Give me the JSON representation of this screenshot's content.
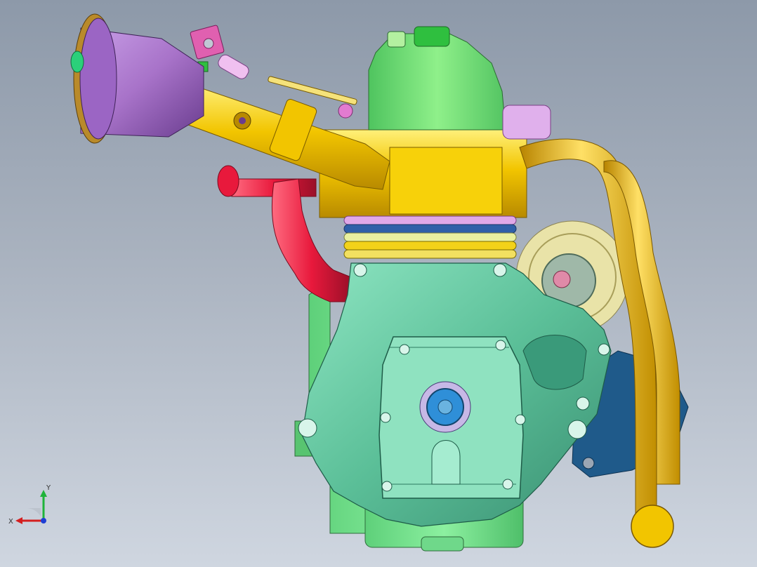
{
  "viewport": {
    "background_top": "#8d99a9",
    "background_bottom": "#cfd6e0"
  },
  "model": {
    "parts": [
      {
        "name": "air-filter",
        "color": "#a873c9"
      },
      {
        "name": "intake-pipe",
        "color": "#f2c500"
      },
      {
        "name": "cylinder-head",
        "color": "#7be07c"
      },
      {
        "name": "cylinder-block",
        "color": "#f7d10a"
      },
      {
        "name": "exhaust-header",
        "color": "#f0b400"
      },
      {
        "name": "red-hose",
        "color": "#e8193c"
      },
      {
        "name": "crankcase-cover",
        "color": "#6fd1a8"
      },
      {
        "name": "crankcase",
        "color": "#6ddc8a"
      },
      {
        "name": "mount-bracket",
        "color": "#1f5a8a"
      }
    ]
  },
  "triad": {
    "x_label": "X",
    "y_label": "Y",
    "x_color": "#d41f1f",
    "y_color": "#1fb33a",
    "z_color": "#1f3fd4"
  }
}
